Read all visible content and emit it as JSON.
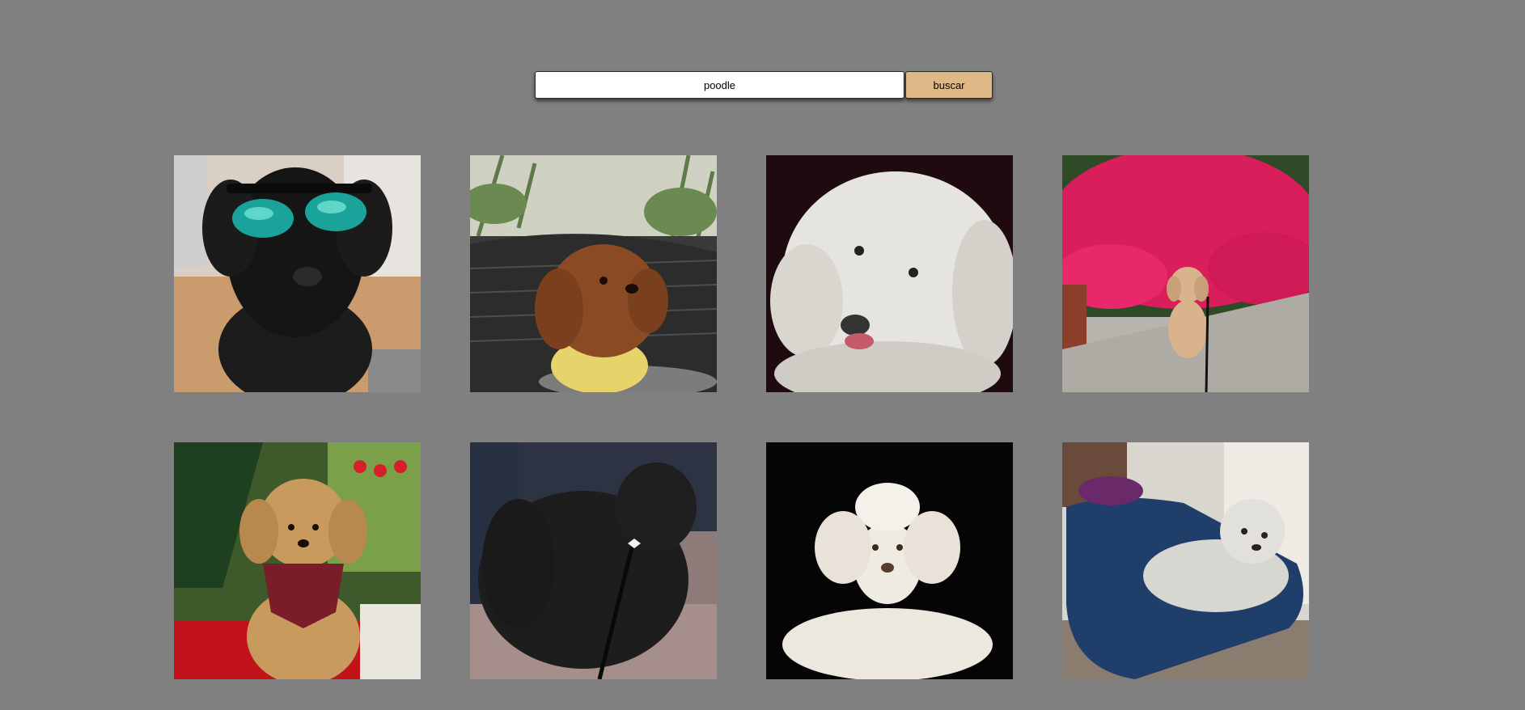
{
  "search": {
    "value": "poodle",
    "button_label": "buscar"
  },
  "gallery": {
    "images": [
      {
        "subject": "black-poodle-sunglasses-photo"
      },
      {
        "subject": "brown-poodle-wicker-chair-photo"
      },
      {
        "subject": "white-curly-poodle-closeup-photo"
      },
      {
        "subject": "apricot-poodle-pink-flowers-photo"
      },
      {
        "subject": "apricot-poodle-christmas-photo"
      },
      {
        "subject": "black-poodle-on-leash-photo"
      },
      {
        "subject": "white-poodle-black-background-photo"
      },
      {
        "subject": "white-poodle-blue-bed-photo"
      }
    ]
  }
}
